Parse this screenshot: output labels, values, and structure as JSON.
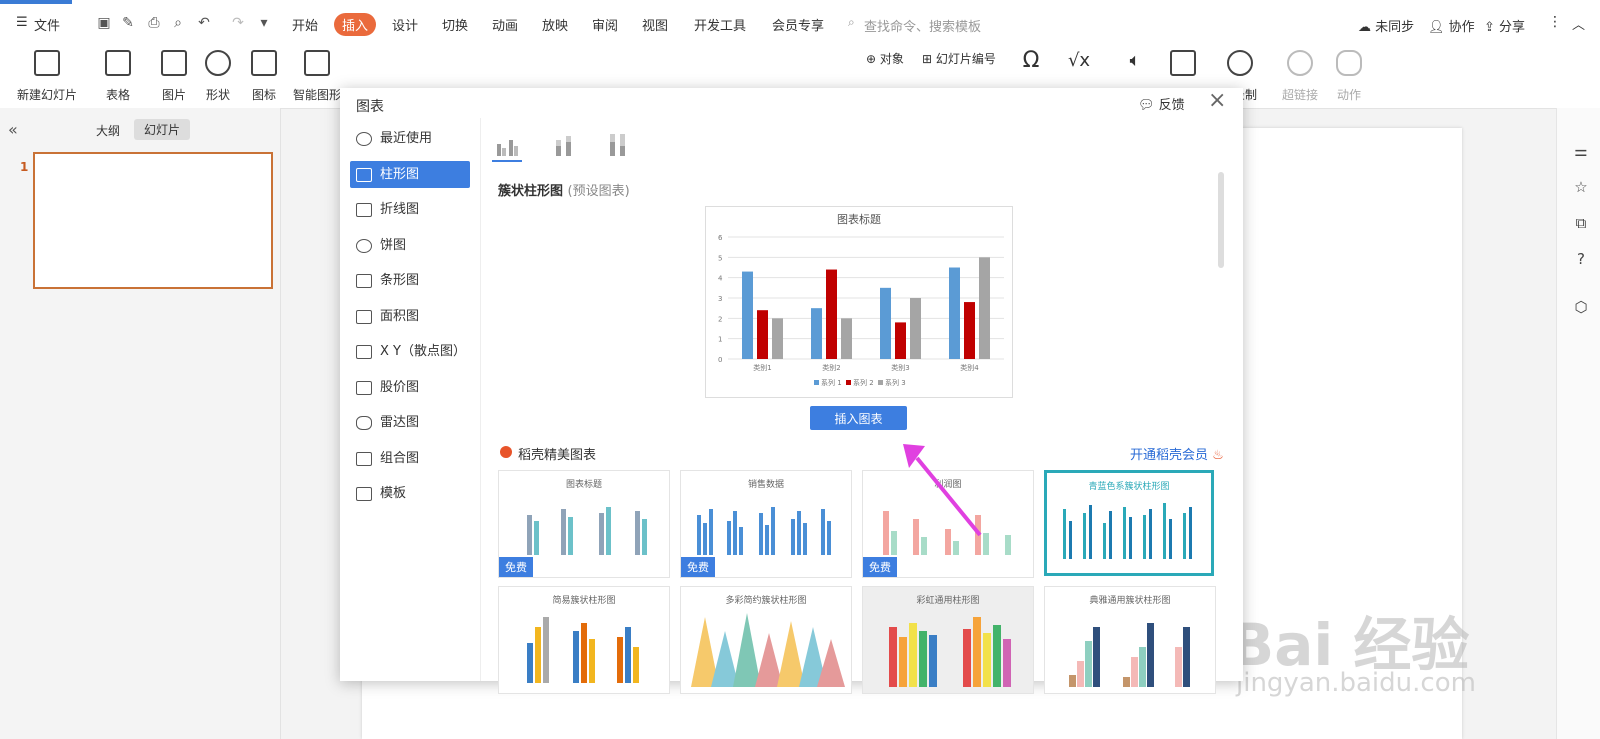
{
  "menu": {
    "file": "文件",
    "tabs": [
      "开始",
      "插入",
      "设计",
      "切换",
      "动画",
      "放映",
      "审阅",
      "视图",
      "开发工具",
      "会员专享"
    ],
    "active_tab": "插入",
    "search_placeholder": "查找命令、搜索模板",
    "unsync": "未同步",
    "collab": "协作",
    "share": "分享"
  },
  "ribbon": {
    "new_slide": "新建幻灯片",
    "table": "表格",
    "picture": "图片",
    "shape": "形状",
    "icon": "图标",
    "smart_graphic": "智能图形",
    "object": "对象",
    "slide_number": "幻灯片编号",
    "hyperlink": "超链接",
    "action": "动作",
    "record": "录制"
  },
  "left_panel": {
    "tab_outline": "大纲",
    "tab_slides": "幻灯片",
    "slide_number": "1"
  },
  "dialog": {
    "title": "图表",
    "feedback": "反馈",
    "nav": [
      "最近使用",
      "柱形图",
      "折线图",
      "饼图",
      "条形图",
      "面积图",
      "X Y（散点图）",
      "股价图",
      "雷达图",
      "组合图",
      "模板"
    ],
    "active_nav": "柱形图",
    "subtype_title": "簇状柱形图",
    "subtype_note": "(预设图表)",
    "insert_button": "插入图表",
    "premium_label": "稻壳精美图表",
    "vip_link": "开通稻壳会员",
    "templates": [
      {
        "title": "图表标题",
        "badge": "免费"
      },
      {
        "title": "销售数据",
        "badge": "免费"
      },
      {
        "title": "利润图",
        "badge": "免费"
      },
      {
        "title": "青蓝色系簇状柱形图",
        "badge": ""
      },
      {
        "title": "简易簇状柱形图",
        "badge": ""
      },
      {
        "title": "多彩简约簇状柱形图",
        "badge": ""
      },
      {
        "title": "彩虹通用柱形图",
        "badge": ""
      },
      {
        "title": "典雅通用簇状柱形图",
        "badge": ""
      }
    ]
  },
  "chart_data": {
    "type": "bar",
    "title": "图表标题",
    "categories": [
      "类别1",
      "类别2",
      "类别3",
      "类别4"
    ],
    "series": [
      {
        "name": "系列 1",
        "values": [
          4.3,
          2.5,
          3.5,
          4.5
        ],
        "color": "#5b9bd5"
      },
      {
        "name": "系列 2",
        "values": [
          2.4,
          4.4,
          1.8,
          2.8
        ],
        "color": "#c00000"
      },
      {
        "name": "系列 3",
        "values": [
          2.0,
          2.0,
          3.0,
          5.0
        ],
        "color": "#a5a5a5"
      }
    ],
    "ylim": [
      0,
      6
    ],
    "yticks": [
      0,
      1,
      2,
      3,
      4,
      5,
      6
    ],
    "legend": "bottom",
    "grid": true
  },
  "watermark": {
    "main": "Bai 经验",
    "sub": "jingyan.baidu.com"
  }
}
